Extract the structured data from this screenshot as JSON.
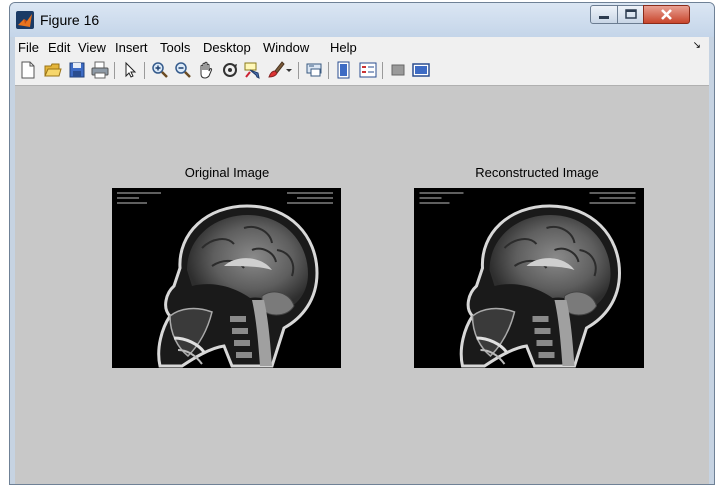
{
  "window": {
    "title": "Figure 16"
  },
  "menubar": {
    "items": [
      "File",
      "Edit",
      "View",
      "Insert",
      "Tools",
      "Desktop",
      "Window",
      "Help"
    ]
  },
  "toolbar": {
    "buttons": [
      {
        "name": "new-figure-icon"
      },
      {
        "name": "open-file-icon"
      },
      {
        "name": "save-figure-icon"
      },
      {
        "name": "print-figure-icon"
      },
      {
        "name": "edit-plot-arrow-icon"
      },
      {
        "name": "zoom-in-icon"
      },
      {
        "name": "zoom-out-icon"
      },
      {
        "name": "pan-hand-icon"
      },
      {
        "name": "rotate-3d-icon"
      },
      {
        "name": "data-cursor-icon"
      },
      {
        "name": "brush-data-icon"
      },
      {
        "name": "link-plot-icon"
      },
      {
        "name": "insert-colorbar-icon"
      },
      {
        "name": "insert-legend-icon"
      },
      {
        "name": "hide-plot-tools-icon"
      },
      {
        "name": "show-plot-tools-icon"
      }
    ]
  },
  "axes": [
    {
      "title": "Original Image"
    },
    {
      "title": "Reconstructed Image"
    }
  ],
  "colors": {
    "figure_bg": "#c8c8c8",
    "menubar_bg": "#f0f0f0",
    "image_bg": "#000000"
  }
}
